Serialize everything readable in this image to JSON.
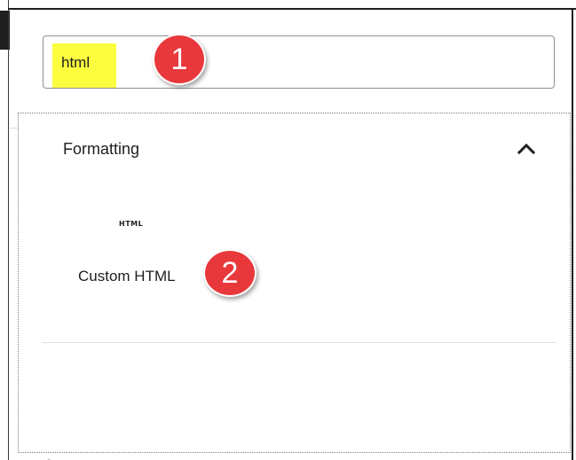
{
  "search": {
    "value": "html",
    "highlight_color": "#fdfd40"
  },
  "callouts": {
    "first": "1",
    "second": "2",
    "color": "#e8383c"
  },
  "category": {
    "title": "Formatting",
    "toggle_icon": "chevron-up-icon",
    "expanded": true
  },
  "blocks": [
    {
      "icon_text": "HTML",
      "label": "Custom HTML"
    }
  ]
}
